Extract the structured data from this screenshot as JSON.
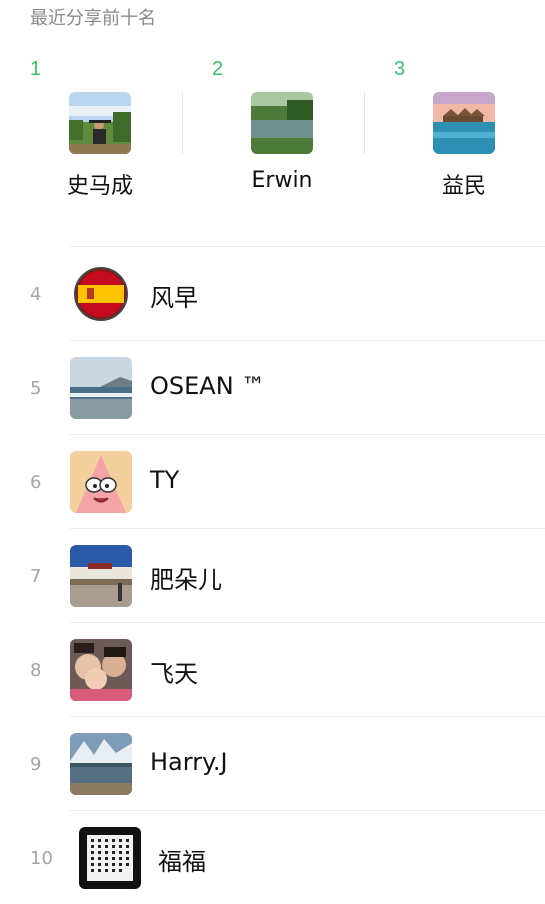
{
  "header": {
    "title": "最近分享前十名"
  },
  "top3": [
    {
      "rank": "1",
      "name": "史马成",
      "avatar": "person-outdoors-photo"
    },
    {
      "rank": "2",
      "name": "Erwin",
      "avatar": "lake-landscape-photo"
    },
    {
      "rank": "3",
      "name": "益民",
      "avatar": "sea-huts-sunset-photo"
    }
  ],
  "list": [
    {
      "rank": "4",
      "name": "风早",
      "avatar": "spain-flag-badge"
    },
    {
      "rank": "5",
      "name": "OSEAN ™",
      "avatar": "beach-waves-photo"
    },
    {
      "rank": "6",
      "name": "TY",
      "avatar": "cartoon-starfish"
    },
    {
      "rank": "7",
      "name": "肥朵儿",
      "avatar": "palace-plaza-photo"
    },
    {
      "rank": "8",
      "name": "飞天",
      "avatar": "family-selfie-photo"
    },
    {
      "rank": "9",
      "name": "Harry.J",
      "avatar": "snow-mountain-lake-photo"
    },
    {
      "rank": "10",
      "name": "福福",
      "avatar": "calligraphy-text-image"
    }
  ],
  "colors": {
    "rank_top": "#3bbf6a",
    "rank_list": "#a5a5a5",
    "divider": "#ececec"
  }
}
